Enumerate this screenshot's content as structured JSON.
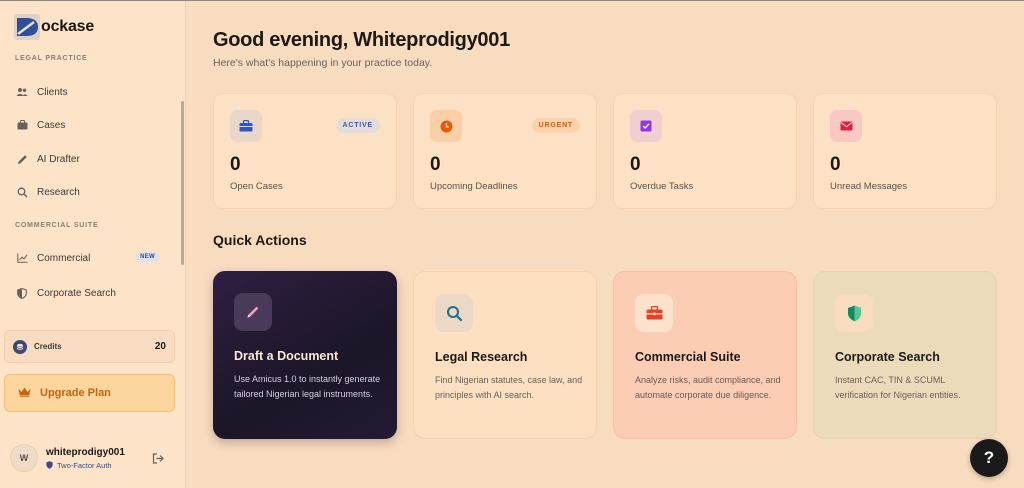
{
  "brand": {
    "logo_letter": "D",
    "name": "ockase"
  },
  "sidebar": {
    "section_legal": "LEGAL PRACTICE",
    "legal_items": [
      {
        "label": "Clients",
        "icon": "users-icon"
      },
      {
        "label": "Cases",
        "icon": "briefcase-icon"
      },
      {
        "label": "AI Drafter",
        "icon": "pencil-icon"
      },
      {
        "label": "Research",
        "icon": "search-icon"
      }
    ],
    "section_commercial": "COMMERCIAL SUITE",
    "commercial_items": [
      {
        "label": "Commercial",
        "icon": "chart-icon",
        "badge": "NEW"
      },
      {
        "label": "Corporate Search",
        "icon": "shield-icon"
      }
    ],
    "credits": {
      "label": "Credits",
      "value": "20"
    },
    "upgrade": {
      "label": "Upgrade Plan"
    },
    "user": {
      "initial": "W",
      "name": "whiteprodigy001",
      "security": "Two-Factor Auth"
    }
  },
  "main": {
    "greeting": "Good evening, Whiteprodigy001",
    "subtitle": "Here's what's happening in your practice today.",
    "stats": [
      {
        "value": "0",
        "label": "Open Cases",
        "badge": "ACTIVE",
        "icon": "briefcase-icon",
        "accent": "#2f54c8"
      },
      {
        "value": "0",
        "label": "Upcoming Deadlines",
        "badge": "URGENT",
        "icon": "clock-icon",
        "accent": "#ea580c"
      },
      {
        "value": "0",
        "label": "Overdue Tasks",
        "icon": "check-square-icon",
        "accent": "#9333ea"
      },
      {
        "value": "0",
        "label": "Unread Messages",
        "icon": "mail-icon",
        "accent": "#e11d48"
      }
    ],
    "quick_actions_title": "Quick Actions",
    "quick_actions": [
      {
        "title": "Draft a Document",
        "desc": "Use Amicus 1.0 to instantly generate tailored Nigerian legal instruments.",
        "icon": "pen-icon"
      },
      {
        "title": "Legal Research",
        "desc": "Find Nigerian statutes, case law, and principles with AI search.",
        "icon": "search-icon"
      },
      {
        "title": "Commercial Suite",
        "desc": "Analyze risks, audit compliance, and automate corporate due diligence.",
        "icon": "briefcase-icon"
      },
      {
        "title": "Corporate Search",
        "desc": "Instant CAC, TIN & SCUML verification for Nigerian entities.",
        "icon": "shield-icon"
      }
    ]
  },
  "help": {
    "label": "?"
  },
  "colors": {
    "background": "#f8dcc0",
    "sidebar": "#fde3c8",
    "upgrade_text": "#c8620f",
    "dark_card": "#1e1530"
  }
}
